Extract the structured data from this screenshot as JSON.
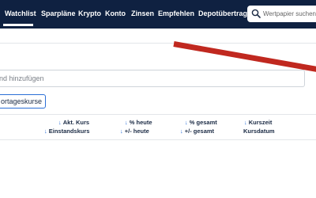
{
  "nav": {
    "items": [
      "Watchlist",
      "Sparpläne",
      "Krypto",
      "Konto",
      "Zinsen",
      "Empfehlen",
      "Depotübertrag"
    ],
    "active": "Watchlist"
  },
  "search": {
    "placeholder": "Wertpapier suchen"
  },
  "add_field": {
    "placeholder": "nd hinzufügen"
  },
  "vortag_button": {
    "label": "ortageskurse"
  },
  "columns": {
    "akt_kurs": "Akt. Kurs",
    "einstandskurs": "Einstandskurs",
    "pct_heute": "% heute",
    "pm_heute": "+/- heute",
    "pct_gesamt": "% gesamt",
    "pm_gesamt": "+/- gesamt",
    "kurszeit": "Kurszeit",
    "kursdatum": "Kursdatum"
  },
  "colors": {
    "nav_bg": "#0f2141",
    "accent": "#2b6fd6",
    "annotation": "#c0281f"
  }
}
